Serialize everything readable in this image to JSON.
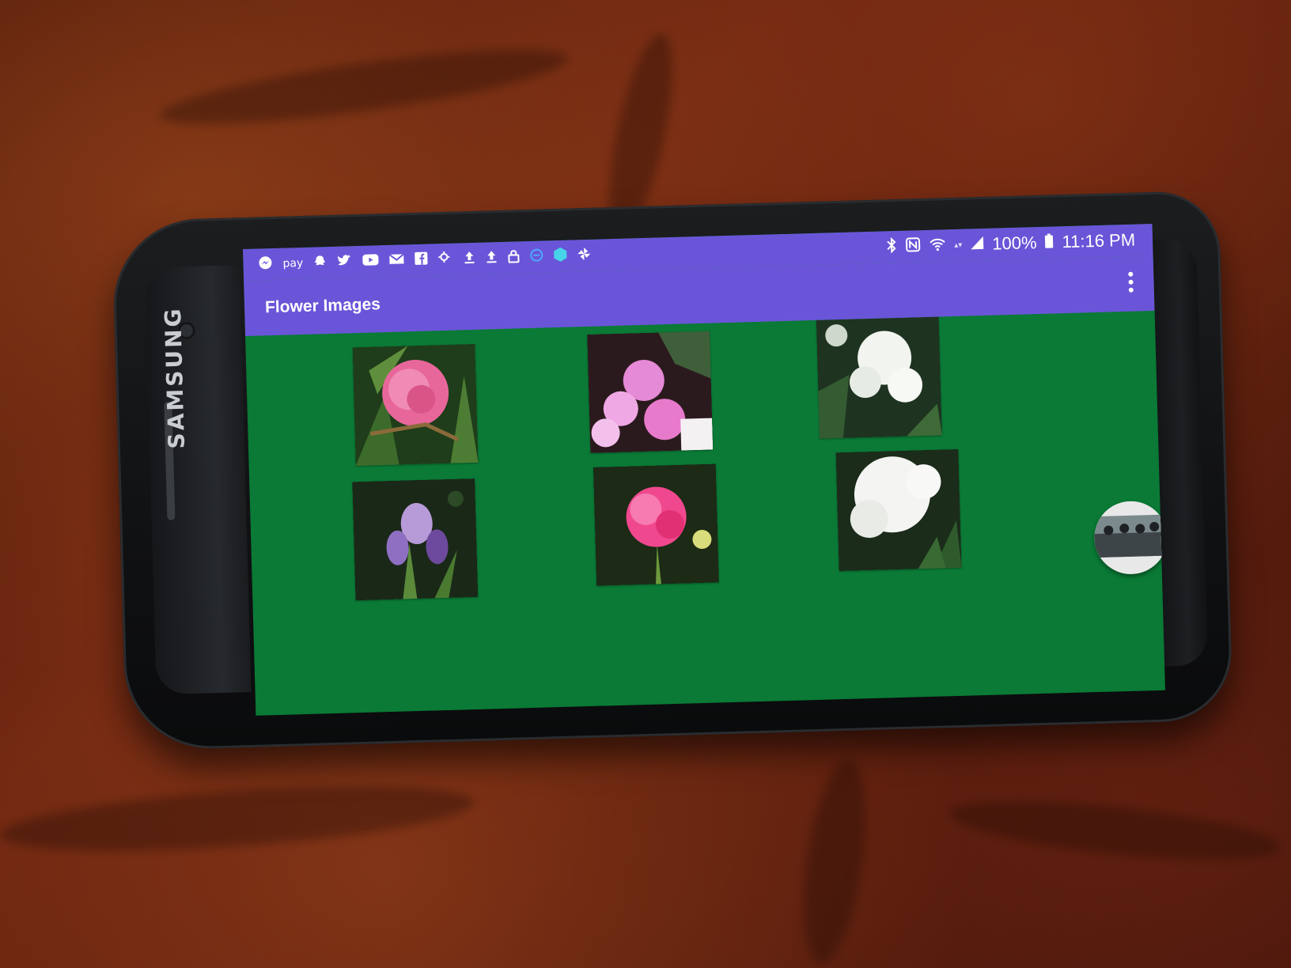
{
  "device": {
    "brand": "SAMSUNG"
  },
  "status_bar": {
    "notification_icons": [
      "messenger-icon",
      "samsung-pay-icon",
      "snapchat-icon",
      "twitter-icon",
      "youtube-icon",
      "email-icon",
      "facebook-icon",
      "weather-icon",
      "upload-icon",
      "upload-icon",
      "lock-icon",
      "sync-icon",
      "hexagon-app-icon",
      "pinwheel-icon"
    ],
    "pay_label": "pay",
    "battery_percent": "100%",
    "time": "11:16 PM"
  },
  "app_bar": {
    "title": "Flower Images",
    "overflow_icon": "more-vert-icon"
  },
  "gallery": {
    "items": [
      {
        "subject": "pink peony",
        "color": "#e8679b"
      },
      {
        "subject": "pink impatiens",
        "color": "#e58ad6"
      },
      {
        "subject": "white flowering shrub",
        "color": "#f1f4ef"
      },
      {
        "subject": "purple iris",
        "color": "#b79ad8"
      },
      {
        "subject": "pink geranium",
        "color": "#f0488e"
      },
      {
        "subject": "white lilac cluster",
        "color": "#f4f5f2"
      }
    ]
  },
  "colors": {
    "app_bar": "#6a55d8",
    "background": "#0a7a36"
  }
}
